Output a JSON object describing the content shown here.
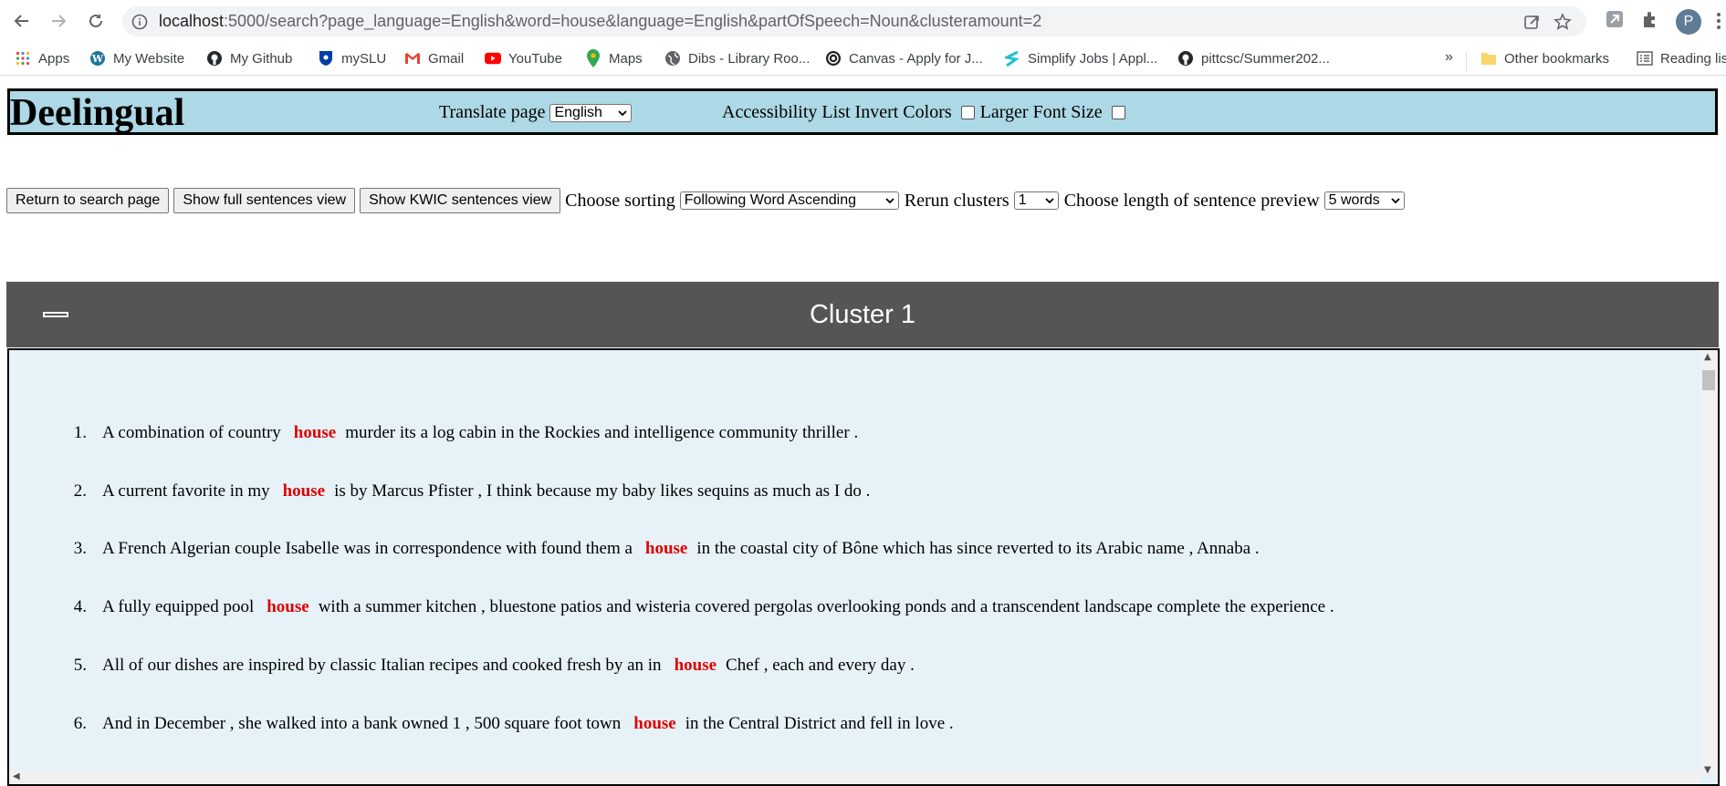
{
  "browser": {
    "url_host": "localhost",
    "url_rest": ":5000/search?page_language=English&word=house&language=English&partOfSpeech=Noun&clusteramount=2",
    "profile_initial": "P",
    "bookmarks": [
      {
        "label": "Apps",
        "icon": "apps-grid-icon"
      },
      {
        "label": "My Website",
        "icon": "wordpress-icon"
      },
      {
        "label": "My Github",
        "icon": "github-icon"
      },
      {
        "label": "mySLU",
        "icon": "slu-shield-icon"
      },
      {
        "label": "Gmail",
        "icon": "gmail-icon"
      },
      {
        "label": "YouTube",
        "icon": "youtube-icon"
      },
      {
        "label": "Maps",
        "icon": "maps-pin-icon"
      },
      {
        "label": "Dibs - Library Roo...",
        "icon": "globe-icon"
      },
      {
        "label": "Canvas - Apply for J...",
        "icon": "canvas-icon"
      },
      {
        "label": "Simplify Jobs | Appl...",
        "icon": "simplify-icon"
      },
      {
        "label": "pittcsc/Summer202...",
        "icon": "github-icon"
      }
    ],
    "bookmarks_more": "»",
    "other_bookmarks": "Other bookmarks",
    "reading_list": "Reading lis"
  },
  "header": {
    "title": "Deelingual",
    "translate_label": "Translate page",
    "translate_value": "English",
    "accessibility_label": "Accessibility List",
    "invert_label": "Invert Colors",
    "larger_font_label": "Larger Font Size"
  },
  "controls": {
    "return_button": "Return to search page",
    "full_button": "Show full sentences view",
    "kwic_button": "Show KWIC sentences view",
    "sorting_label": "Choose sorting",
    "sorting_value": "Following Word Ascending",
    "rerun_label": "Rerun clusters",
    "rerun_value": "1",
    "length_label": "Choose length of sentence preview",
    "length_value": "5 words"
  },
  "cluster": {
    "title": "Cluster 1",
    "sentences": [
      {
        "num": "1.",
        "before": "A combination of country",
        "keyword": "house",
        "after": "murder its a log cabin in the Rockies and intelligence community thriller ."
      },
      {
        "num": "2.",
        "before": "A current favorite in my",
        "keyword": "house",
        "after": "is by Marcus Pfister , I think because my baby likes sequins as much as I do ."
      },
      {
        "num": "3.",
        "before": "A French Algerian couple Isabelle was in correspondence with found them a",
        "keyword": "house",
        "after": "in the coastal city of Bône which has since reverted to its Arabic name , Annaba ."
      },
      {
        "num": "4.",
        "before": "A fully equipped pool",
        "keyword": "house",
        "after": "with a summer kitchen , bluestone patios and wisteria covered pergolas overlooking ponds and a transcendent landscape complete the experience ."
      },
      {
        "num": "5.",
        "before": "All of our dishes are inspired by classic Italian recipes and cooked fresh by an in",
        "keyword": "house",
        "after": "Chef , each and every day ."
      },
      {
        "num": "6.",
        "before": "And in December , she walked into a bank owned 1 , 500 square foot town",
        "keyword": "house",
        "after": "in the Central District and fell in love ."
      }
    ]
  }
}
